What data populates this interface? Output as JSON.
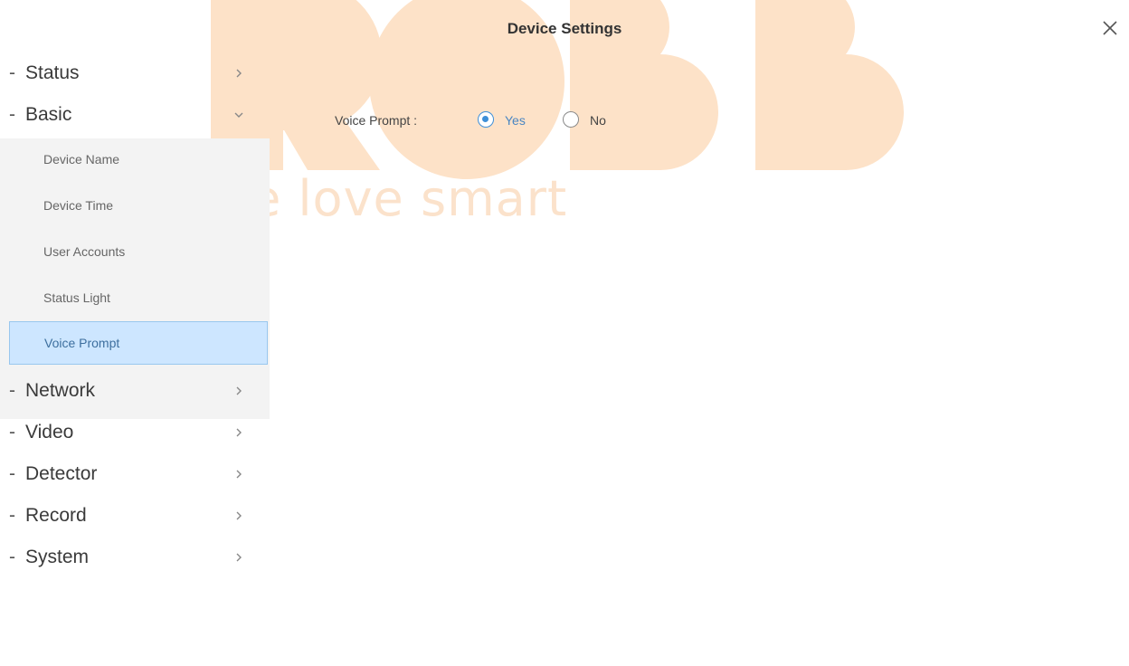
{
  "window": {
    "title": "Device Settings"
  },
  "watermark": {
    "brand": "ROBB",
    "tagline": "we love smart",
    "color": "#fde2c8"
  },
  "sidebar": {
    "sections": [
      {
        "label": "Status",
        "expanded": false,
        "icon": "chevron-right-icon"
      },
      {
        "label": "Basic",
        "expanded": true,
        "icon": "chevron-down-icon"
      },
      {
        "label": "Network",
        "expanded": false,
        "icon": "chevron-right-icon"
      },
      {
        "label": "Video",
        "expanded": false,
        "icon": "chevron-right-icon"
      },
      {
        "label": "Detector",
        "expanded": false,
        "icon": "chevron-right-icon"
      },
      {
        "label": "Record",
        "expanded": false,
        "icon": "chevron-right-icon"
      },
      {
        "label": "System",
        "expanded": false,
        "icon": "chevron-right-icon"
      }
    ],
    "basic_items": [
      {
        "label": "Device Name",
        "active": false
      },
      {
        "label": "Device Time",
        "active": false
      },
      {
        "label": "User Accounts",
        "active": false
      },
      {
        "label": "Status Light",
        "active": false
      },
      {
        "label": "Voice Prompt",
        "active": true
      }
    ]
  },
  "main": {
    "voice_prompt": {
      "label": "Voice Prompt :",
      "options": [
        {
          "label": "Yes",
          "checked": true
        },
        {
          "label": "No",
          "checked": false
        }
      ]
    }
  },
  "colors": {
    "accent": "#3d8fd8",
    "active_bg": "#cde6ff",
    "submenu_bg": "#f3f3f3"
  }
}
